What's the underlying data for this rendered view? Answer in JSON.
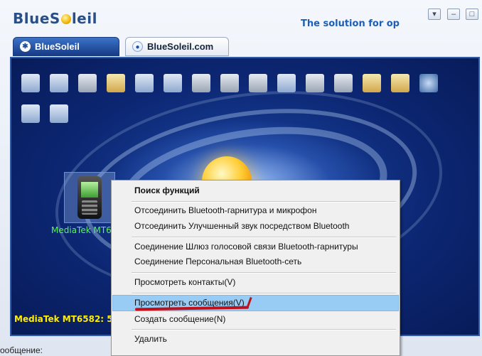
{
  "app": {
    "logo": "BlueSoleil",
    "slogan": "The solution for op"
  },
  "window_buttons": {
    "menu": "▾",
    "minimize": "–",
    "maximize": "□"
  },
  "tabs": [
    {
      "label": "BlueSoleil"
    },
    {
      "label": "BlueSoleil.com"
    }
  ],
  "toolbar_icons": [
    "dialup-networking-icon",
    "lan-access-icon",
    "fax-icon",
    "file-transfer-icon",
    "network-icon",
    "business-card-icon",
    "printer-icon",
    "mouse-icon",
    "keyboard-icon",
    "image-icon",
    "headset-icon",
    "audio-icon",
    "pim-icon",
    "sync-icon",
    "internet-icon",
    "person-icon",
    "serial-port-icon"
  ],
  "device": {
    "label": "MediaTek MT6"
  },
  "status": {
    "text": "MediaTek MT6582: 5 с"
  },
  "bottom_text": "ообщение:",
  "context_menu": {
    "items": [
      {
        "label": "Поиск функций"
      },
      {
        "label": "Отсоединить Bluetooth-гарнитура и микрофон"
      },
      {
        "label": "Отсоединить Улучшенный звук посредством Bluetooth"
      },
      {
        "label": "Соединение Шлюз голосовой связи Bluetooth-гарнитуры"
      },
      {
        "label": "Соединение Персональная Bluetooth-сеть"
      },
      {
        "label": "Просмотреть контакты(V)"
      },
      {
        "label": "Просмотреть сообщения(V)"
      },
      {
        "label": "Создать сообщение(N)"
      },
      {
        "label": "Удалить"
      }
    ]
  }
}
